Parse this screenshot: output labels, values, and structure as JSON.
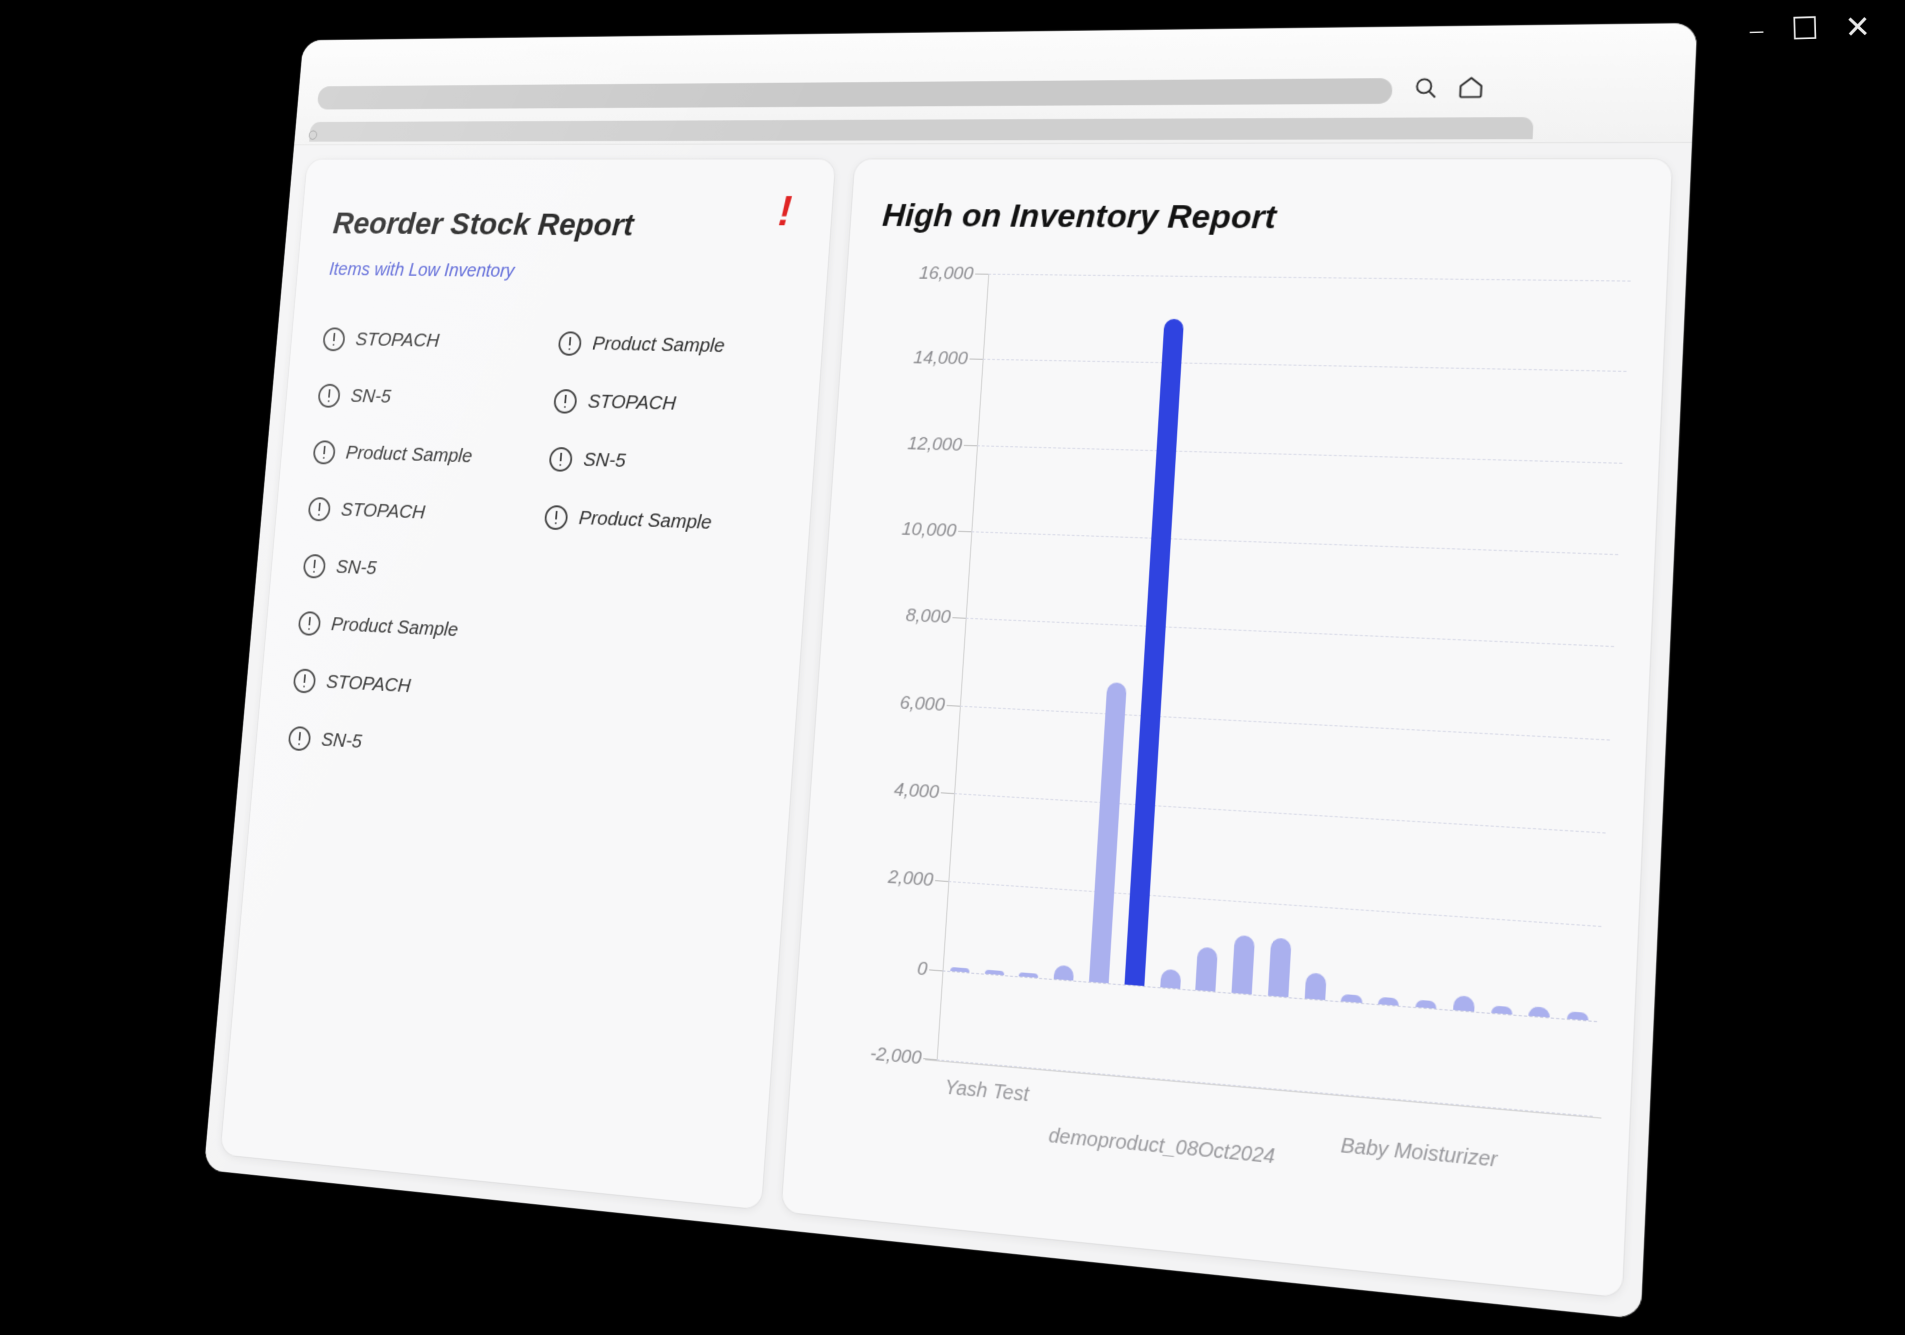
{
  "window": {
    "controls": [
      {
        "name": "minimize",
        "glyph": "–"
      },
      {
        "name": "maximize",
        "glyph": "☐"
      },
      {
        "name": "close",
        "glyph": "✕"
      }
    ],
    "address_bar_value": "",
    "address_bar_placeholder": "",
    "tab_favicon_text": "○",
    "icons": [
      "search-icon",
      "home-icon"
    ]
  },
  "reorder_card": {
    "title": "Reorder Stock Report",
    "subtitle": "Items with Low Inventory",
    "alert_badge": "!",
    "columns": [
      {
        "items": [
          {
            "label": "STOPACH"
          },
          {
            "label": "SN-5"
          },
          {
            "label": "Product Sample"
          },
          {
            "label": "STOPACH"
          },
          {
            "label": "SN-5"
          },
          {
            "label": "Product Sample"
          },
          {
            "label": "STOPACH"
          },
          {
            "label": "SN-5"
          }
        ]
      },
      {
        "items": [
          {
            "label": "Product Sample"
          },
          {
            "label": "STOPACH"
          },
          {
            "label": "SN-5"
          },
          {
            "label": "Product Sample"
          }
        ]
      }
    ]
  },
  "inventory_card": {
    "title": "High on Inventory Report"
  },
  "chart_data": {
    "type": "bar",
    "title": "High on Inventory Report",
    "xlabel": "",
    "ylabel": "",
    "ylim": [
      -2000,
      16000
    ],
    "yticks": [
      16000,
      14000,
      12000,
      10000,
      8000,
      6000,
      4000,
      2000,
      0,
      -2000
    ],
    "ytick_labels": [
      "16,000",
      "14,000",
      "12,000",
      "10,000",
      "8,000",
      "6,000",
      "4,000",
      "2,000",
      "0",
      "-2,000"
    ],
    "grid": true,
    "legend": "none",
    "colors": {
      "bar": "#aab0ee",
      "highlight": "#2f43e0",
      "gridline": "#d6d8e6",
      "axis": "#cfcfcf"
    },
    "visible_xtick_labels": [
      {
        "label": "Yash Test",
        "index": 1
      },
      {
        "label": "demoproduct_08Oct2024",
        "index": 6
      },
      {
        "label": "Baby Moisturizer",
        "index": 13
      }
    ],
    "categories": [
      "",
      "Yash Test",
      "",
      "",
      "",
      "",
      "demoproduct_08Oct2024",
      "",
      "",
      "",
      "",
      "",
      "",
      "Baby Moisturizer",
      "",
      "",
      "",
      ""
    ],
    "values": [
      0,
      0,
      0,
      300,
      6700,
      15000,
      400,
      950,
      1250,
      1250,
      560,
      120,
      160,
      130,
      300,
      90,
      200,
      80
    ],
    "highlight_index": 5
  }
}
